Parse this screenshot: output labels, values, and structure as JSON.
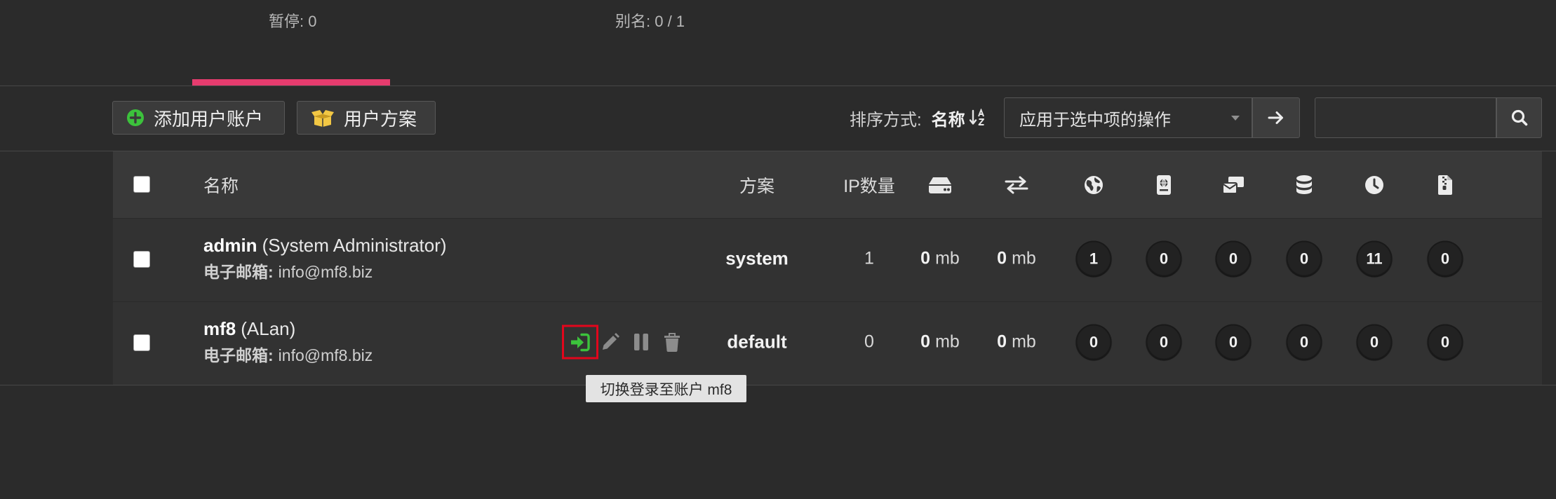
{
  "summary": {
    "paused": "暂停: 0",
    "aliases": "别名: 0 / 1"
  },
  "toolbar": {
    "add_user_label": "添加用户账户",
    "add_user_icon": "plus-circle-icon",
    "plans_label": "用户方案",
    "plans_icon": "box-open-icon",
    "sort_label": "排序方式:",
    "sort_value": "名称",
    "sort_icon": "sort-alpha-down-icon",
    "bulk_action_select": "应用于选中项的操作",
    "apply_icon": "arrow-right-icon",
    "search_icon": "search-icon"
  },
  "table": {
    "headers": {
      "name": "名称",
      "plan": "方案",
      "ip_count": "IP数量",
      "icons": [
        "hard-drive-icon",
        "exchange-icon",
        "globe-icon",
        "passport-icon",
        "mail-bulk-icon",
        "database-icon",
        "clock-icon",
        "file-archive-icon"
      ]
    },
    "rows": [
      {
        "username": "admin",
        "display_name": "(System Administrator)",
        "email_label": "电子邮箱:",
        "email": "info@mf8.biz",
        "plan": "system",
        "ip_count": "1",
        "disk_value": "0",
        "disk_unit": "mb",
        "bandwidth_value": "0",
        "bandwidth_unit": "mb",
        "counts": [
          "1",
          "0",
          "0",
          "0",
          "11",
          "0"
        ]
      },
      {
        "username": "mf8",
        "display_name": "(ALan)",
        "email_label": "电子邮箱:",
        "email": "info@mf8.biz",
        "actions": [
          "sign-in-icon",
          "pencil-icon",
          "pause-icon",
          "trash-icon"
        ],
        "plan": "default",
        "ip_count": "0",
        "disk_value": "0",
        "disk_unit": "mb",
        "bandwidth_value": "0",
        "bandwidth_unit": "mb",
        "counts": [
          "0",
          "0",
          "0",
          "0",
          "0",
          "0"
        ]
      }
    ]
  },
  "tooltip": "切换登录至账户 mf8",
  "colors": {
    "background": "#2b2b2b",
    "active_tab": "#e63c6e",
    "login_icon": "#3cc23c",
    "highlight_box": "#e2061c",
    "box_icon": "#f2c744"
  }
}
